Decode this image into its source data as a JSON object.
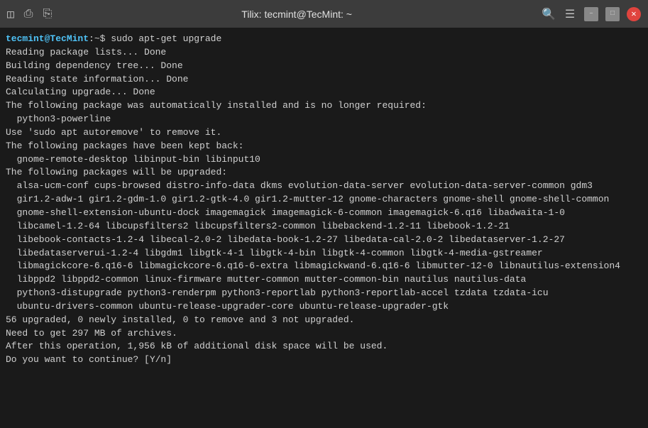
{
  "titlebar": {
    "title": "Tilix: tecmint@TecMint: ~",
    "icons_left": [
      "terminal-icon1",
      "terminal-icon2",
      "terminal-icon3"
    ],
    "icons_right": [
      "search-icon",
      "menu-icon",
      "minimize-icon",
      "maximize-icon",
      "close-icon"
    ]
  },
  "terminal": {
    "prompt_user": "tecmint@TecMint:",
    "prompt_symbol": "~$",
    "command": " sudo apt-get upgrade",
    "lines": [
      "Reading package lists... Done",
      "Building dependency tree... Done",
      "Reading state information... Done",
      "Calculating upgrade... Done",
      "The following package was automatically installed and is no longer required:",
      "  python3-powerline",
      "Use 'sudo apt autoremove' to remove it.",
      "The following packages have been kept back:",
      "  gnome-remote-desktop libinput-bin libinput10",
      "The following packages will be upgraded:",
      "  alsa-ucm-conf cups-browsed distro-info-data dkms evolution-data-server evolution-data-server-common gdm3",
      "  gir1.2-adw-1 gir1.2-gdm-1.0 gir1.2-gtk-4.0 gir1.2-mutter-12 gnome-characters gnome-shell gnome-shell-common",
      "  gnome-shell-extension-ubuntu-dock imagemagick imagemagick-6-common imagemagick-6.q16 libadwaita-1-0",
      "  libcamel-1.2-64 libcupsfilters2 libcupsfilters2-common libebackend-1.2-11 libebook-1.2-21",
      "  libebook-contacts-1.2-4 libecal-2.0-2 libedata-book-1.2-27 libedata-cal-2.0-2 libedataserver-1.2-27",
      "  libedataserverui-1.2-4 libgdm1 libgtk-4-1 libgtk-4-bin libgtk-4-common libgtk-4-media-gstreamer",
      "  libmagickcore-6.q16-6 libmagickcore-6.q16-6-extra libmagickwand-6.q16-6 libmutter-12-0 libnautilus-extension4",
      "  libppd2 libppd2-common linux-firmware mutter-common mutter-common-bin nautilus nautilus-data",
      "  python3-distupgrade python3-renderpm python3-reportlab python3-reportlab-accel tzdata tzdata-icu",
      "  ubuntu-drivers-common ubuntu-release-upgrader-core ubuntu-release-upgrader-gtk",
      "56 upgraded, 0 newly installed, 0 to remove and 3 not upgraded.",
      "Need to get 297 MB of archives.",
      "After this operation, 1,956 kB of additional disk space will be used.",
      "Do you want to continue? [Y/n]"
    ]
  }
}
